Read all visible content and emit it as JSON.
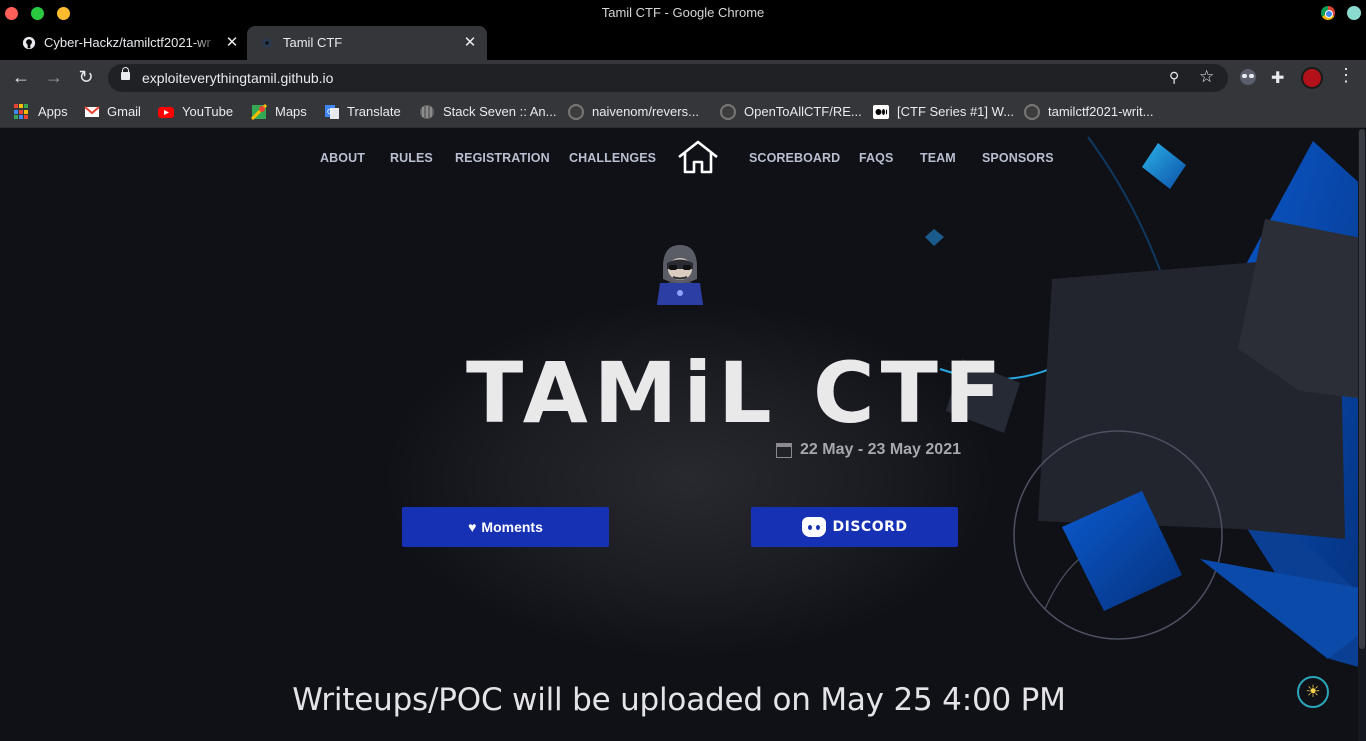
{
  "window": {
    "title": "Tamil CTF - Google Chrome"
  },
  "tabs": [
    {
      "label": "Cyber-Hackz/tamilctf2021-wr",
      "active": false
    },
    {
      "label": "Tamil CTF",
      "active": true
    }
  ],
  "address_bar": {
    "url": "exploiteverythingtamil.github.io"
  },
  "bookmarks": [
    {
      "label": "Apps",
      "icon": "apps-grid-icon"
    },
    {
      "label": "Gmail",
      "icon": "gmail-icon"
    },
    {
      "label": "YouTube",
      "icon": "youtube-icon"
    },
    {
      "label": "Maps",
      "icon": "maps-icon"
    },
    {
      "label": "Translate",
      "icon": "translate-icon"
    },
    {
      "label": "Stack Seven :: An...",
      "icon": "stack-seven-icon"
    },
    {
      "label": "naivenom/revers...",
      "icon": "github-icon"
    },
    {
      "label": "OpenToAllCTF/RE...",
      "icon": "github-icon"
    },
    {
      "label": "[CTF Series #1] W...",
      "icon": "medium-icon"
    },
    {
      "label": "tamilctf2021-writ...",
      "icon": "github-icon"
    }
  ],
  "site_nav": {
    "left": [
      "ABOUT",
      "RULES",
      "REGISTRATION",
      "CHALLENGES"
    ],
    "right": [
      "SCOREBOARD",
      "FAQS",
      "TEAM",
      "SPONSORS"
    ]
  },
  "hero": {
    "logo_text": "TAMiL CTF",
    "date": "22 May - 23 May 2021"
  },
  "buttons": {
    "moments": "Moments",
    "discord": "DISCORD"
  },
  "announcement": "Writeups/POC will be uploaded on May 25 4:00 PM",
  "colors": {
    "page_bg": "#0f1117",
    "button_blue": "#1631b4",
    "accent_cyan": "#2aa6b8",
    "decor_blue": "#0a4fb3"
  }
}
